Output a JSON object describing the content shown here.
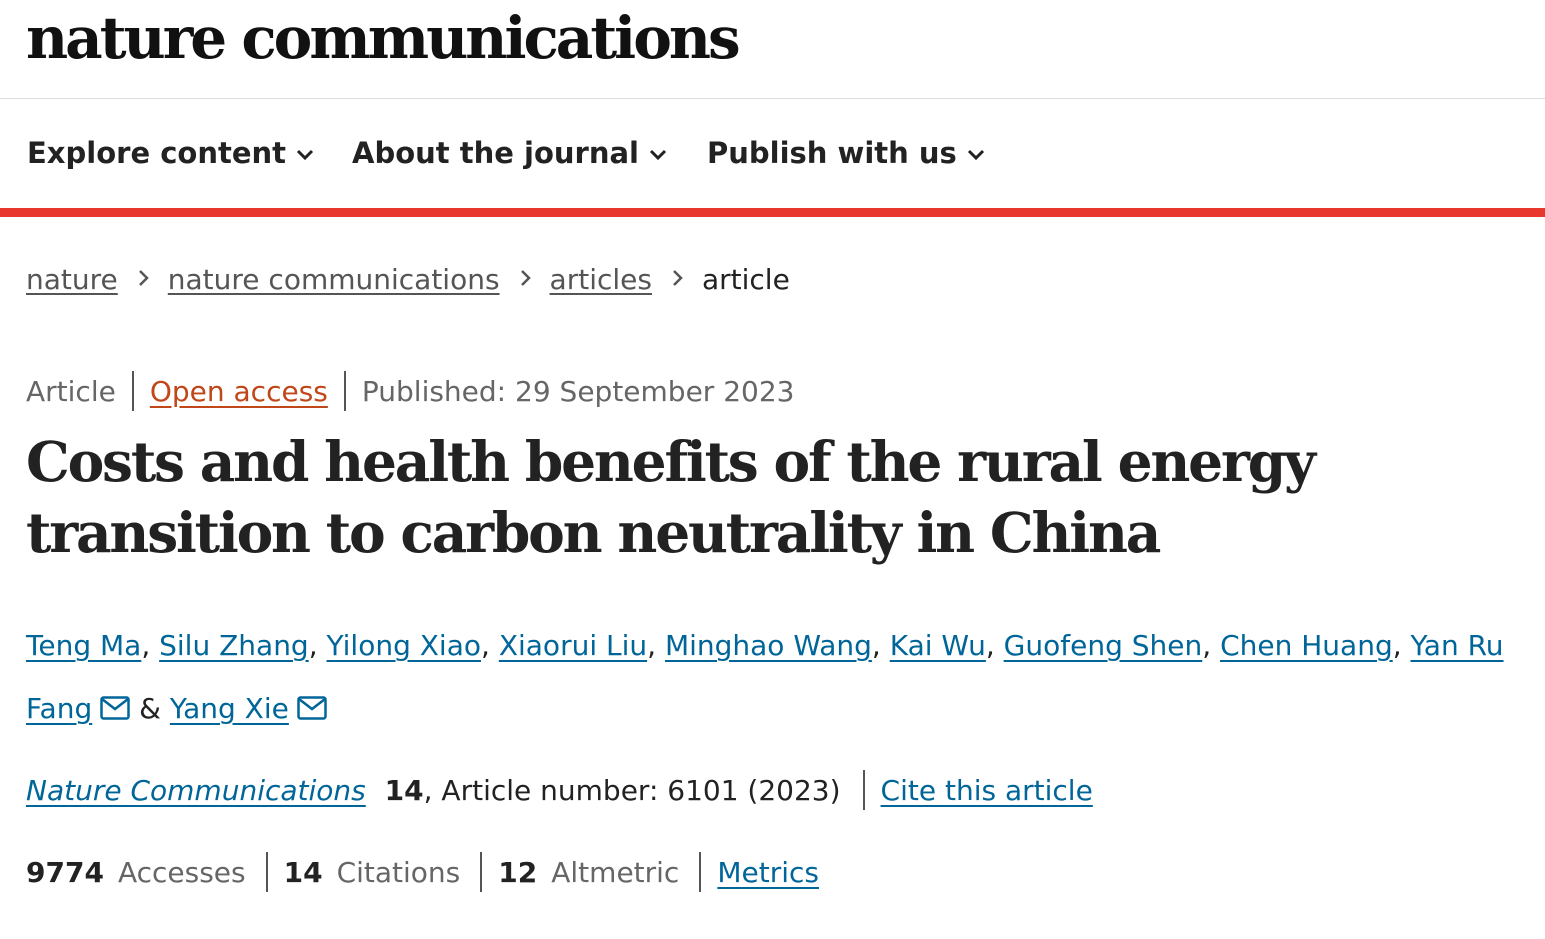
{
  "masthead": {
    "logo": "nature communications"
  },
  "nav": {
    "items": [
      {
        "label": "Explore content"
      },
      {
        "label": "About the journal"
      },
      {
        "label": "Publish with us"
      }
    ]
  },
  "breadcrumb": {
    "items": [
      "nature",
      "nature communications",
      "articles"
    ],
    "current": "article"
  },
  "article": {
    "type": "Article",
    "access": "Open access",
    "published": "Published: 29 September 2023",
    "title": "Costs and health benefits of the rural energy transition to carbon neutrality in China",
    "authors": [
      "Teng Ma",
      "Silu Zhang",
      "Yilong Xiao",
      "Xiaorui Liu",
      "Minghao Wang",
      "Kai Wu",
      "Guofeng Shen",
      "Chen Huang",
      "Yan Ru Fang",
      "Yang Xie"
    ],
    "author_separator": ", ",
    "author_last_separator": " & ",
    "journal": "Nature Communications",
    "volume": "14",
    "article_number": ", Article number: 6101 (2023)",
    "cite_label": "Cite this article"
  },
  "metrics": {
    "accesses_value": "9774",
    "accesses_label": "Accesses",
    "citations_value": "14",
    "citations_label": "Citations",
    "altmetric_value": "12",
    "altmetric_label": "Altmetric",
    "metrics_link": "Metrics"
  },
  "colors": {
    "accent_red": "#e8372c",
    "link_blue": "#006699",
    "open_access_orange": "#c0471a"
  },
  "icons": {
    "nav_chevron": "chevron-down-icon",
    "breadcrumb_separator": "chevron-right-icon",
    "corresponding_author": "mail-icon"
  }
}
